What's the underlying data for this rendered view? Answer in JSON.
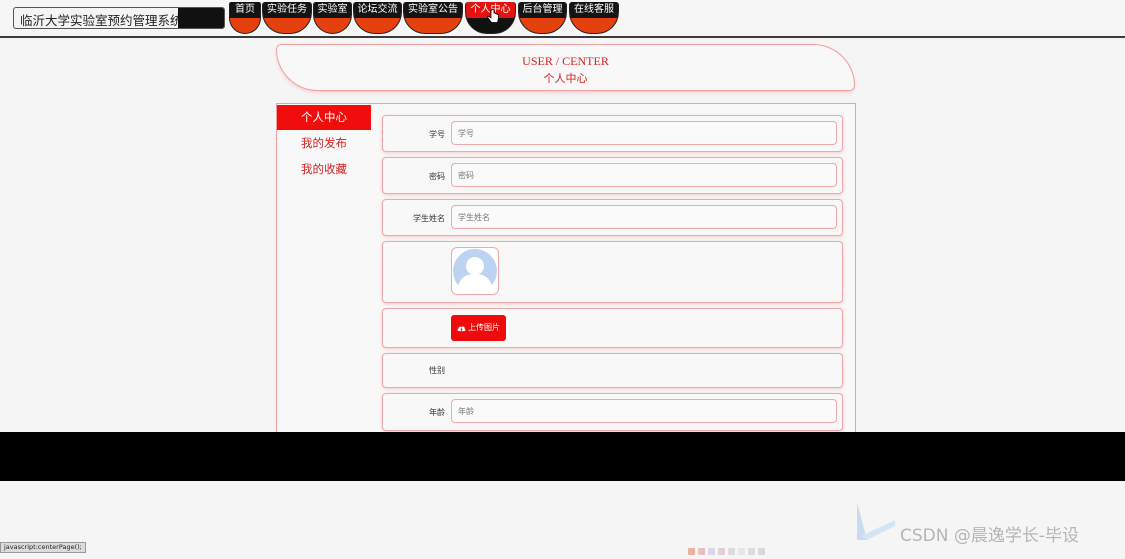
{
  "site": {
    "title": "临沂大学实验室预约管理系统"
  },
  "nav": {
    "items": [
      {
        "label": "首页"
      },
      {
        "label": "实验任务"
      },
      {
        "label": "实验室"
      },
      {
        "label": "论坛交流"
      },
      {
        "label": "实验室公告"
      },
      {
        "label": "个人中心",
        "active": true
      },
      {
        "label": "后台管理"
      },
      {
        "label": "在线客服"
      }
    ]
  },
  "header": {
    "title_en": "USER / CENTER",
    "title_cn": "个人中心"
  },
  "sidebar": {
    "items": [
      {
        "label": "个人中心",
        "active": true
      },
      {
        "label": "我的发布"
      },
      {
        "label": "我的收藏"
      }
    ]
  },
  "form": {
    "student_no": {
      "label": "学号",
      "placeholder": "学号"
    },
    "password": {
      "label": "密码",
      "placeholder": "密码"
    },
    "student_name": {
      "label": "学生姓名",
      "placeholder": "学生姓名"
    },
    "upload_label": "上传图片",
    "gender": {
      "label": "性别"
    },
    "age": {
      "label": "年龄",
      "placeholder": "年龄"
    }
  },
  "status_bar": {
    "text": "javascript:centerPage();"
  },
  "watermark": {
    "text": "CSDN @晨逸学长-毕设"
  },
  "colors": {
    "accent": "#e3130f",
    "nav_bottom": "#e5410f",
    "border_pink": "#f0a8a8",
    "text_red": "#d52020"
  }
}
